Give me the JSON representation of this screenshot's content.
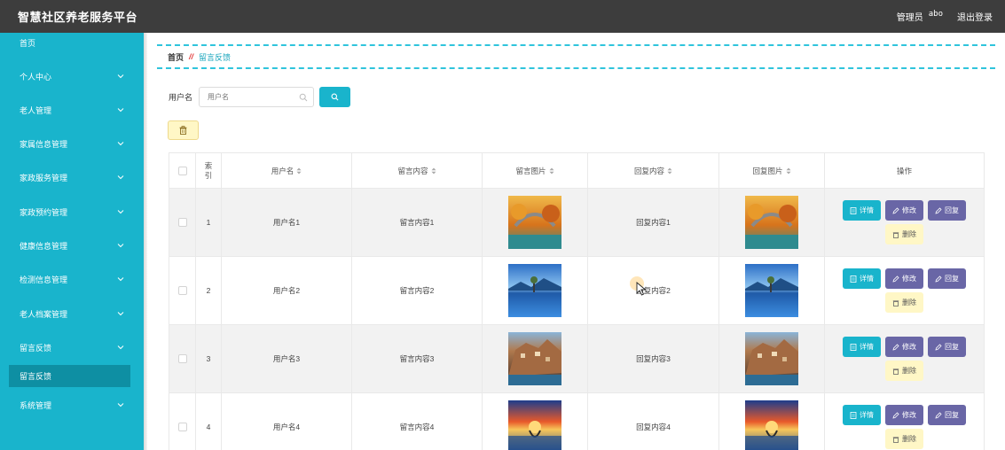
{
  "header": {
    "title": "智慧社区养老服务平台",
    "role": "管理员",
    "username": "abo",
    "logout": "退出登录"
  },
  "sidebar": {
    "items": [
      {
        "label": "首页",
        "has_chevron": false
      },
      {
        "label": "个人中心",
        "has_chevron": true
      },
      {
        "label": "老人管理",
        "has_chevron": true
      },
      {
        "label": "家属信息管理",
        "has_chevron": true
      },
      {
        "label": "家政服务管理",
        "has_chevron": true
      },
      {
        "label": "家政预约管理",
        "has_chevron": true
      },
      {
        "label": "健康信息管理",
        "has_chevron": true
      },
      {
        "label": "检测信息管理",
        "has_chevron": true
      },
      {
        "label": "老人档案管理",
        "has_chevron": true
      },
      {
        "label": "留言反馈",
        "has_chevron": true
      },
      {
        "label": "系统管理",
        "has_chevron": true
      }
    ],
    "active_sub": "留言反馈"
  },
  "breadcrumb": {
    "home": "首页",
    "separator": "//",
    "current": "留言反馈"
  },
  "search": {
    "label": "用户名",
    "placeholder": "用户名"
  },
  "table": {
    "headers": {
      "index": "索引",
      "username": "用户名",
      "message": "留言内容",
      "message_image": "留言图片",
      "reply": "回复内容",
      "reply_image": "回复图片",
      "actions": "操作"
    },
    "actions": {
      "detail": "详情",
      "edit": "修改",
      "reply": "回复",
      "delete": "删除"
    },
    "rows": [
      {
        "index": "1",
        "username": "用户名1",
        "message": "留言内容1",
        "reply": "回复内容1",
        "image": "autumn-bridge"
      },
      {
        "index": "2",
        "username": "用户名2",
        "message": "留言内容2",
        "reply": "回复内容2",
        "image": "lake-mountain"
      },
      {
        "index": "3",
        "username": "用户名3",
        "message": "留言内容3",
        "reply": "回复内容3",
        "image": "cliff-village"
      },
      {
        "index": "4",
        "username": "用户名4",
        "message": "留言内容4",
        "reply": "回复内容4",
        "image": "sunset-sea"
      }
    ]
  },
  "colors": {
    "sidebar": "#19b4cc",
    "topbar": "#3d3d3d",
    "primary": "#19b4cc",
    "secondary": "#6966a6",
    "warning": "#fff7c6"
  }
}
